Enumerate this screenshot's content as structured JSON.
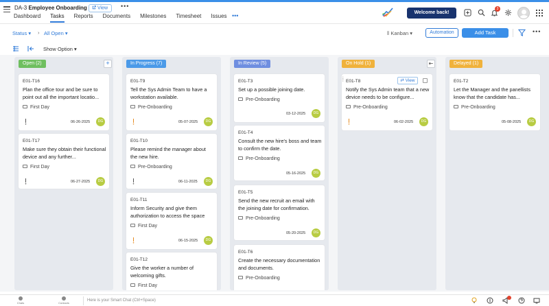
{
  "header": {
    "project_code": "DA-3",
    "project_name": "Employee Onboarding",
    "view_label": "View",
    "more_label": "•••",
    "welcome": "Welcome back!",
    "notification_count": "3",
    "tabs": [
      {
        "label": "Dashboard",
        "active": false
      },
      {
        "label": "Tasks",
        "active": true
      },
      {
        "label": "Reports",
        "active": false
      },
      {
        "label": "Documents",
        "active": false
      },
      {
        "label": "Milestones",
        "active": false
      },
      {
        "label": "Timesheet",
        "active": false
      },
      {
        "label": "Issues",
        "active": false
      }
    ],
    "tabs_more": "•••"
  },
  "toolbar": {
    "status_label": "Status ▾",
    "separator": "›",
    "filter_label": "All Open ▾",
    "kanban_label": "Kanban ▾",
    "automation_label": "Automation",
    "add_task_label": "Add Task",
    "more_label": "•••",
    "show_option_label": "Show Option ▾"
  },
  "columns": [
    {
      "label": "Open (2)",
      "color": "#6fbf5f",
      "cards": [
        {
          "id": "E01-T16",
          "title": "Plan the office tour and be sure to point out all the important locatio...",
          "tag": "First Day",
          "date": "06-26-2025",
          "priority": "low",
          "assignee": "DG"
        },
        {
          "id": "E01-T17",
          "title": "Make sure they obtain their functional device and any further...",
          "tag": "First Day",
          "date": "06-27-2025",
          "priority": "low",
          "assignee": "DG"
        }
      ]
    },
    {
      "label": "In Progress (7)",
      "color": "#4b9ae8",
      "cards": [
        {
          "id": "E01-T9",
          "title": "Tell the Sys Admin Team to have a workstation available.",
          "tag": "Pre-Onboarding",
          "date": "05-07-2025",
          "priority": "medium",
          "assignee": "DG"
        },
        {
          "id": "E01-T10",
          "title": "Please remind the manager about the new hire.",
          "tag": "Pre-Onboarding",
          "date": "06-11-2025",
          "priority": "low",
          "assignee": "DG"
        },
        {
          "id": "E01-T11",
          "title": "Inform Security and give them authorization to access the space",
          "tag": "First Day",
          "date": "06-15-2025",
          "priority": "medium",
          "assignee": "DG"
        },
        {
          "id": "E01-T12",
          "title": "Give the worker a number of welcoming gifts.",
          "tag": "First Day",
          "date": "",
          "priority": "",
          "assignee": ""
        }
      ]
    },
    {
      "label": "In Review (5)",
      "color": "#6f8ee0",
      "cards": [
        {
          "id": "E01-T3",
          "title": "Set up a possible joining date.",
          "tag": "Pre-Onboarding",
          "date": "03-12-2025",
          "priority": "",
          "assignee": "DG"
        },
        {
          "id": "E01-T4",
          "title": "Consult the new hire's boss and team to confirm the date.",
          "tag": "Pre-Onboarding",
          "date": "05-16-2025",
          "priority": "",
          "assignee": "DG"
        },
        {
          "id": "E01-T5",
          "title": "Send the new recruit an email with the joining date for confirmation.",
          "tag": "Pre-Onboarding",
          "date": "05-20-2025",
          "priority": "",
          "assignee": "DG"
        },
        {
          "id": "E01-T6",
          "title": "Create the necessary documentation and documents.",
          "tag": "Pre-Onboarding",
          "date": "",
          "priority": "",
          "assignee": ""
        }
      ]
    },
    {
      "label": "On Hold (1)",
      "color": "#f0b23c",
      "cards": [
        {
          "id": "E01-T8",
          "title": "Notify the Sys Admin team that a new device needs to be configure...",
          "tag": "Pre-Onboarding",
          "date": "06-02-2025",
          "priority": "medium",
          "assignee": "DG",
          "view_label": "View"
        }
      ]
    },
    {
      "label": "Delayed (1)",
      "color": "#f0b23c",
      "cards": [
        {
          "id": "E01-T2",
          "title": "Let the Manager and the panellists know that the candidate has...",
          "tag": "Pre-Onboarding",
          "date": "05-08-2025",
          "priority": "",
          "assignee": "DG"
        }
      ]
    }
  ],
  "footer": {
    "items": [
      "Chats",
      "Contacts"
    ],
    "chat_placeholder": "Here is your Smart Chat (Ctrl+Space)"
  }
}
